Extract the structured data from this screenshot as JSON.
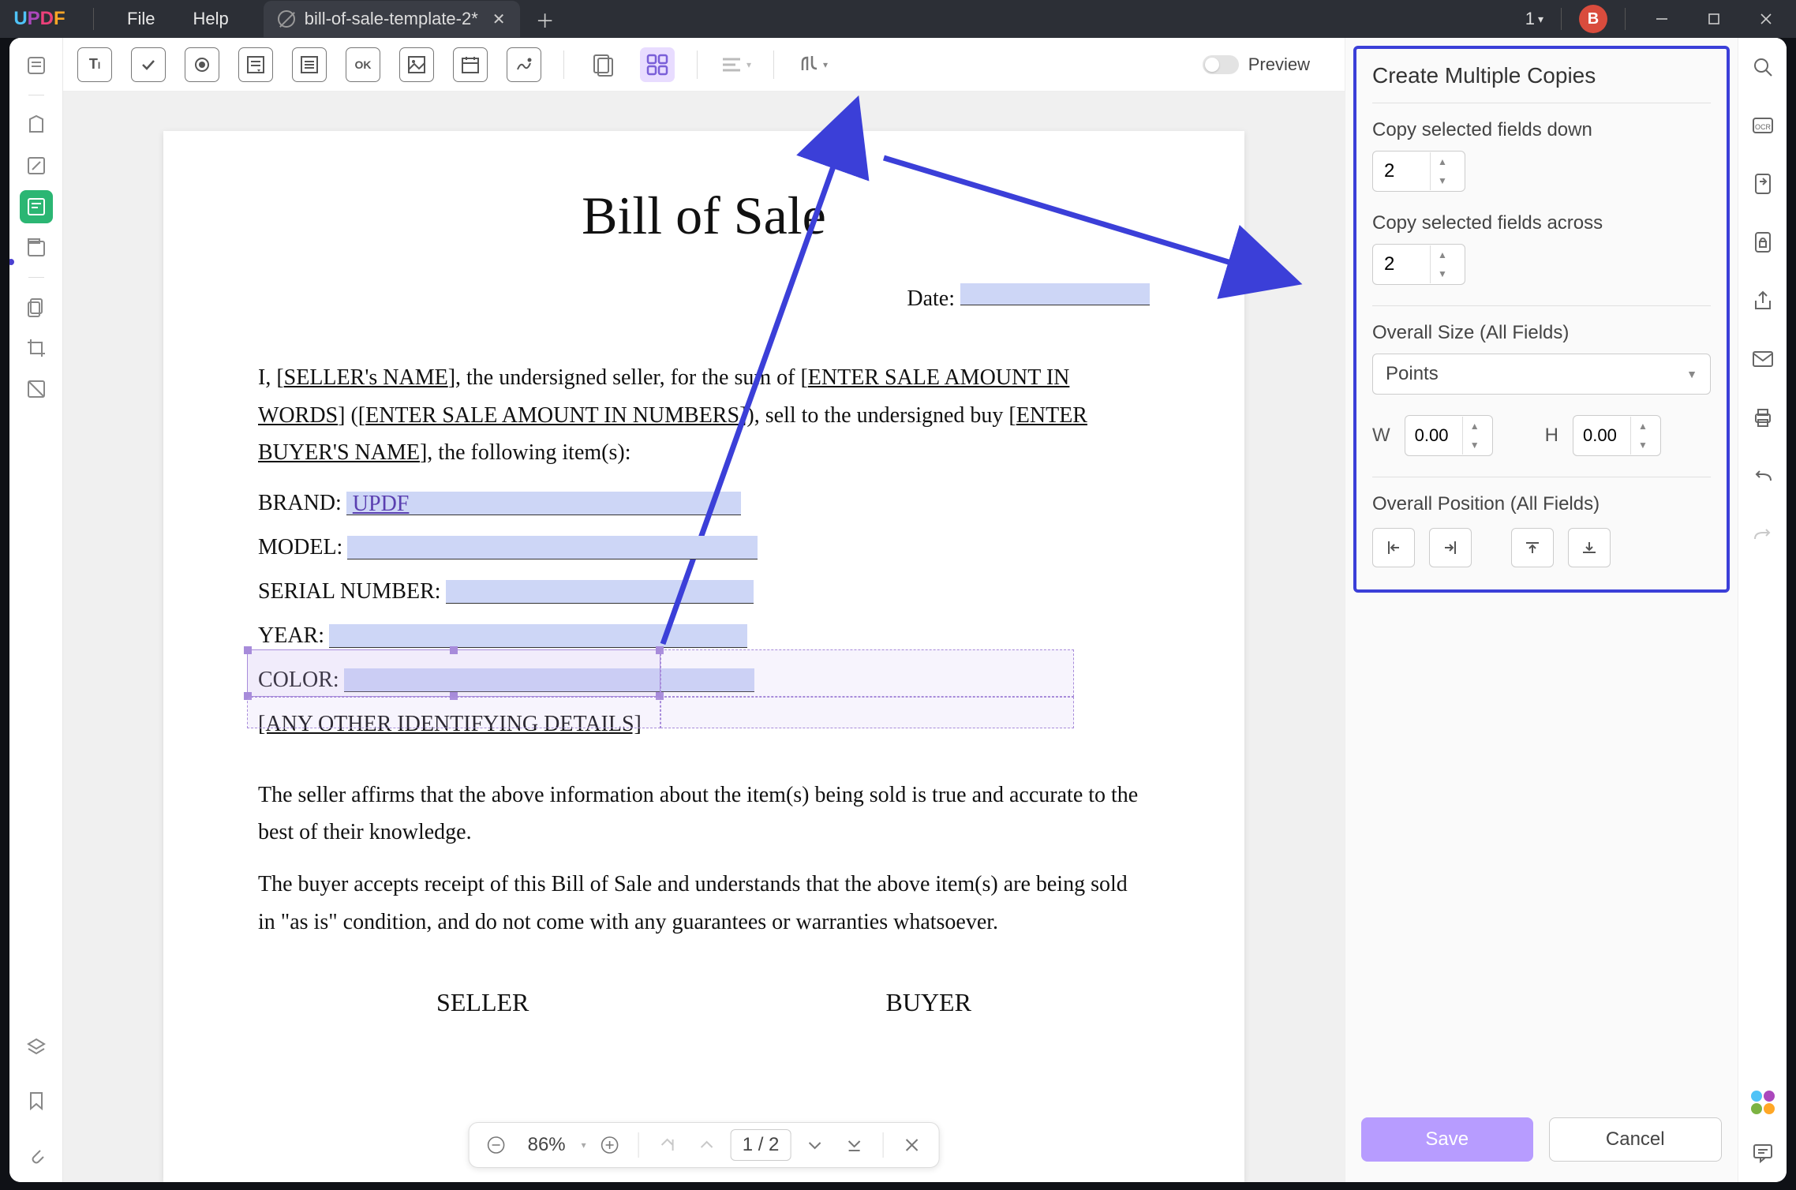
{
  "titlebar": {
    "logo": "UPDF",
    "menus": {
      "file": "File",
      "help": "Help"
    },
    "tab_title": "bill-of-sale-template-2*",
    "badge_num": "1",
    "avatar": "B"
  },
  "toolbar": {
    "preview_label": "Preview"
  },
  "document": {
    "title": "Bill of Sale",
    "date_label": "Date:",
    "para1_a": "I, [",
    "para1_seller": "SELLER's NAME",
    "para1_b": "], the undersigned seller, for the sum of [",
    "para1_words": "ENTER SALE AMOUNT IN WORDS",
    "para1_c": "] ([",
    "para1_numbers": "ENTER SALE AMOUNT IN NUMBERS",
    "para1_d": "]), sell to the undersigned buy [",
    "para1_buyer": "ENTER BUYER'S NAME",
    "para1_e": "], the following item(s):",
    "brand_label": "BRAND:",
    "brand_value": "UPDF",
    "model_label": "MODEL:",
    "serial_label": "SERIAL NUMBER:",
    "year_label": "YEAR:",
    "color_label": "COLOR:",
    "other_label": "[ANY OTHER IDENTIFYING DETAILS]",
    "affirm1": "The seller affirms that the above information about the item(s) being sold is true and accurate to the best of their knowledge.",
    "affirm2": "The buyer accepts receipt of this Bill of Sale and understands that the above item(s) are being sold in \"as is\" condition, and do not come with any guarantees or warranties whatsoever.",
    "seller_h": "SELLER",
    "buyer_h": "BUYER"
  },
  "pagenav": {
    "zoom": "86%",
    "page": "1 / 2"
  },
  "panel": {
    "title": "Create Multiple Copies",
    "copy_down_label": "Copy selected fields down",
    "copy_down_val": "2",
    "copy_across_label": "Copy selected fields across",
    "copy_across_val": "2",
    "overall_size_label": "Overall Size (All Fields)",
    "units": "Points",
    "w_label": "W",
    "w_val": "0.00",
    "h_label": "H",
    "h_val": "0.00",
    "overall_pos_label": "Overall Position (All Fields)",
    "save": "Save",
    "cancel": "Cancel"
  }
}
